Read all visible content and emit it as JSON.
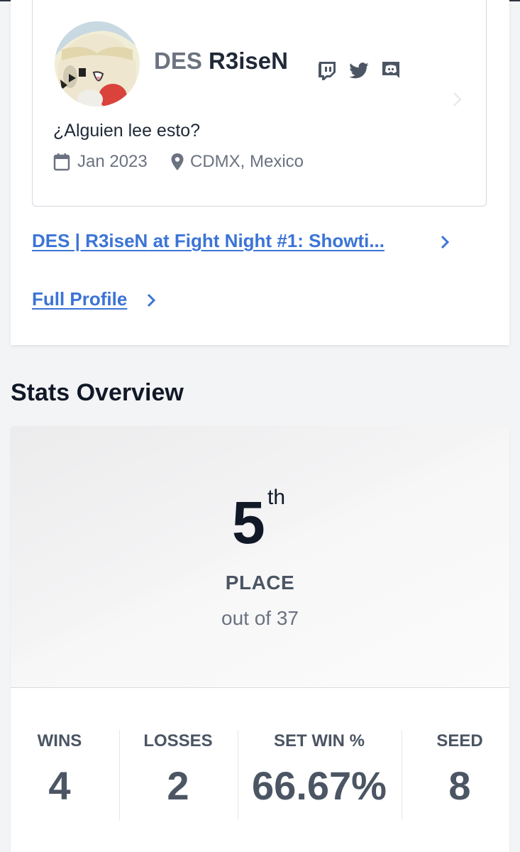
{
  "profile": {
    "prefix": "DES",
    "gamertag": "R3iseN",
    "bio": "¿Alguien lee esto?",
    "joined": "Jan 2023",
    "location": "CDMX, Mexico",
    "social_icons": [
      "twitch-icon",
      "twitter-icon",
      "discord-icon"
    ]
  },
  "links": {
    "event_part1": "DES | R3iseN",
    "event_part2": " at ",
    "event_part3": "Fight Night #1: Showti...",
    "full_profile": "Full Profile"
  },
  "stats": {
    "section_title": "Stats Overview",
    "placement": "5",
    "placement_suffix": "th",
    "placement_label": "PLACE",
    "out_of": "out of 37",
    "items": [
      {
        "label": "WINS",
        "value": "4"
      },
      {
        "label": "LOSSES",
        "value": "2"
      },
      {
        "label": "SET WIN %",
        "value": "66.67%"
      },
      {
        "label": "SEED",
        "value": "8"
      }
    ]
  },
  "colors": {
    "link": "#3b74d6",
    "text_dark": "#111827",
    "text_muted": "#6b7280"
  }
}
